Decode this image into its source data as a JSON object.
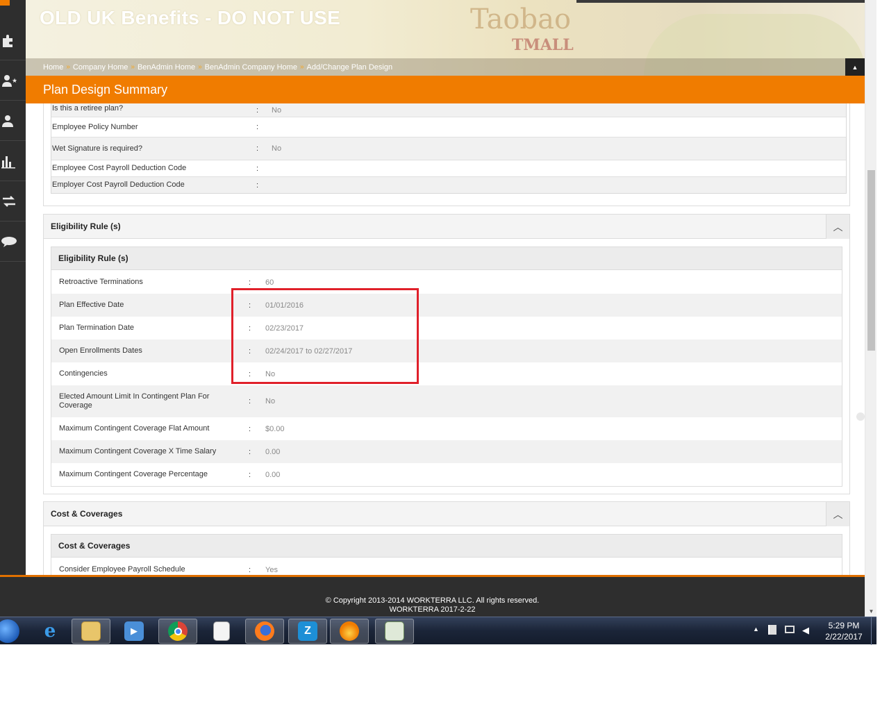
{
  "app": {
    "title": "OLD UK Benefits - DO NOT USE"
  },
  "banner": {
    "art_text": "Taobao",
    "art_text2": "TMALL"
  },
  "breadcrumb": [
    "Home",
    "Company Home",
    "BenAdmin Home",
    "BenAdmin Company Home",
    "Add/Change Plan Design"
  ],
  "page": {
    "title": "Plan Design Summary"
  },
  "plan_rows": [
    {
      "label": "Is this a retiree plan?",
      "value": "No"
    },
    {
      "label": "Employee Policy Number",
      "value": ""
    },
    {
      "label": "Wet Signature is required?",
      "value": "No"
    },
    {
      "label": "Employee Cost Payroll Deduction Code",
      "value": ""
    },
    {
      "label": "Employer Cost Payroll Deduction Code",
      "value": ""
    }
  ],
  "eligibility": {
    "section_title": "Eligibility Rule (s)",
    "inner_title": "Eligibility Rule (s)",
    "rows": [
      {
        "label": "Retroactive Terminations",
        "value": "60"
      },
      {
        "label": "Plan Effective Date",
        "value": "01/01/2016"
      },
      {
        "label": "Plan Termination Date",
        "value": "02/23/2017"
      },
      {
        "label": "Open Enrollments Dates",
        "value": "02/24/2017 to 02/27/2017"
      },
      {
        "label": "Contingencies",
        "value": "No"
      },
      {
        "label": "Elected Amount Limit In Contingent Plan For Coverage",
        "value": "No"
      },
      {
        "label": "Maximum Contingent Coverage Flat Amount",
        "value": "$0.00"
      },
      {
        "label": "Maximum Contingent Coverage X Time Salary",
        "value": "0.00"
      },
      {
        "label": "Maximum Contingent Coverage Percentage",
        "value": "0.00"
      }
    ]
  },
  "cost": {
    "section_title": "Cost & Coverages",
    "inner_title": "Cost & Coverages",
    "rows": [
      {
        "label": "Consider Employee Payroll Schedule",
        "value": "Yes"
      }
    ]
  },
  "separator": ":",
  "footer": {
    "copyright": "© Copyright 2013-2014 WORKTERRA LLC. All rights reserved.",
    "version": "WORKTERRA 2017-2-22"
  },
  "taskbar": {
    "time": "5:29 PM",
    "date": "2/22/2017",
    "z_label": "Z"
  },
  "icons": {
    "toggle_up": "▲",
    "chevron_up": "︿",
    "breadcrumb_sep": "»"
  },
  "colors": {
    "accent": "#f07c00",
    "highlight": "#e0202a",
    "sidebar": "#2e2e2e"
  }
}
